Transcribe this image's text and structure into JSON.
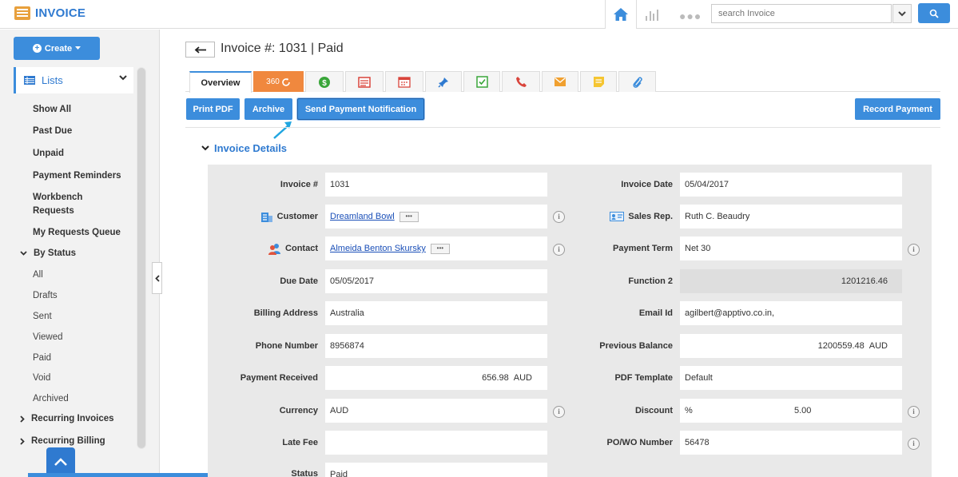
{
  "app": {
    "title": "INVOICE"
  },
  "header": {
    "search_placeholder": "search Invoice"
  },
  "sidebar": {
    "create_label": "Create",
    "lists_label": "Lists",
    "items": [
      "Show All",
      "Past Due",
      "Unpaid",
      "Payment Reminders",
      "Workbench Requests",
      "My Requests Queue"
    ],
    "by_status_label": "By Status",
    "status_items": [
      "All",
      "Drafts",
      "Sent",
      "Viewed",
      "Paid",
      "Void",
      "Archived"
    ],
    "recurring_invoices": "Recurring Invoices",
    "recurring_billing": "Recurring Billing"
  },
  "page": {
    "title": "Invoice #: 1031 | Paid"
  },
  "tabs": {
    "overview": "Overview",
    "t360": "360"
  },
  "actions": {
    "print_pdf": "Print PDF",
    "archive": "Archive",
    "send_payment_notification": "Send Payment Notification",
    "record_payment": "Record Payment"
  },
  "section": {
    "title": "Invoice Details"
  },
  "fields": {
    "invoice_no": {
      "label": "Invoice #",
      "value": "1031"
    },
    "customer": {
      "label": "Customer",
      "value": "Dreamland Bowl"
    },
    "contact": {
      "label": "Contact",
      "value": "Almeida Benton Skursky"
    },
    "due_date": {
      "label": "Due Date",
      "value": "05/05/2017"
    },
    "billing_address": {
      "label": "Billing Address",
      "value": "Australia"
    },
    "phone": {
      "label": "Phone Number",
      "value": "8956874"
    },
    "payment_received": {
      "label": "Payment Received",
      "value": "656.98",
      "unit": "AUD"
    },
    "currency": {
      "label": "Currency",
      "value": "AUD"
    },
    "late_fee": {
      "label": "Late Fee",
      "value": ""
    },
    "status": {
      "label": "Status",
      "value": "Paid"
    },
    "invoice_date": {
      "label": "Invoice Date",
      "value": "05/04/2017"
    },
    "sales_rep": {
      "label": "Sales Rep.",
      "value": "Ruth C. Beaudry"
    },
    "payment_term": {
      "label": "Payment Term",
      "value": "Net 30"
    },
    "function2": {
      "label": "Function 2",
      "value": "1201216.46"
    },
    "email": {
      "label": "Email Id",
      "value": "agilbert@apptivo.co.in,"
    },
    "previous_balance": {
      "label": "Previous Balance",
      "value": "1200559.48",
      "unit": "AUD"
    },
    "pdf_template": {
      "label": "PDF Template",
      "value": "Default"
    },
    "discount": {
      "label": "Discount",
      "type": "%",
      "value": "5.00"
    },
    "po_wo": {
      "label": "PO/WO Number",
      "value": "56478"
    }
  },
  "colors": {
    "accent": "#3c8ddc",
    "brand": "#2f7ad0",
    "orange": "#f0883e"
  }
}
